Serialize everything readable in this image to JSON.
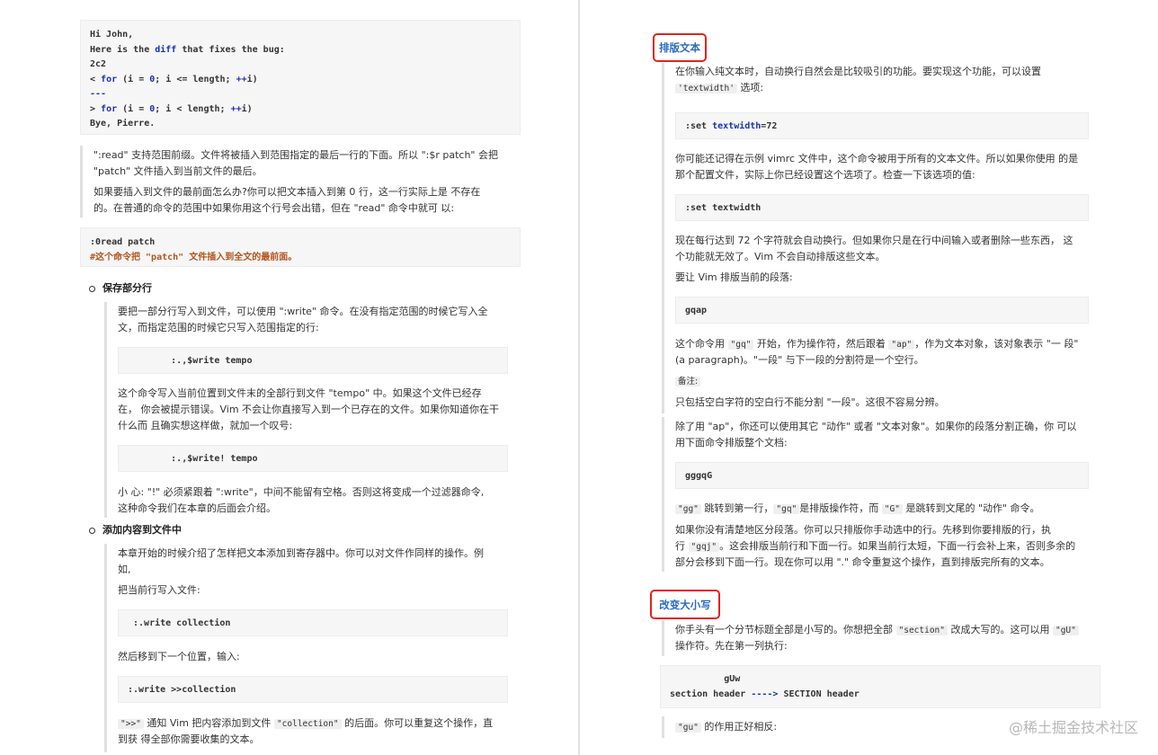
{
  "left": {
    "email_code": [
      "Hi John,",
      "Here is the diff that fixes the bug:",
      "2c2",
      "< for (i = 0; i <= length; ++i)",
      "---",
      "> for (i = 0; i < length; ++i)",
      "Bye, Pierre."
    ],
    "range_note_1": [
      "\":read\" 支持范围前缀。文件将被插入到范围指定的最后一行的下面。所以 \":$r patch\" 会把",
      "\"patch\" 文件插入到当前文件的最后。"
    ],
    "range_note_2": [
      "如果要插入到文件的最前面怎么办?你可以把文本插入到第 0 行，这一行实际上是 不存在",
      "的。在普通的命令的范围中如果你用这个行号会出错，但在 \"read\" 命令中就可 以:"
    ],
    "code_0read": ":0read patch",
    "code_0read_comment": "#这个命令把 \"patch\" 文件插入到全文的最前面。",
    "bullet_1": "保存部分行",
    "save_para_1": [
      "要把一部分行写入到文件，可以使用 \":write\" 命令。在没有指定范围的时候它写入全",
      "文，而指定范围的时候它只写入范围指定的行:"
    ],
    "code_write_tempo": "        :.,$write tempo",
    "save_para_2": [
      "这个命令写入当前位置到文件末的全部行到文件 \"tempo\" 中。如果这个文件已经存",
      "在，  你会被提示错误。Vim 不会让你直接写入到一个已存在的文件。如果你知道你在干",
      "什么而 且确实想这样做，就加一个叹号:"
    ],
    "code_write_tempo_bang": "        :.,$write! tempo",
    "save_para_3": [
      "小 心: \"!\" 必须紧跟着 \":write\"，中间不能留有空格。否则这将变成一个过滤器命令,",
      "这种命令我们在本章的后面会介绍。"
    ],
    "bullet_2": "添加内容到文件中",
    "append_para_1": [
      "本章开始的时候介绍了怎样把文本添加到寄存器中。你可以对文件作同样的操作。例",
      "如,"
    ],
    "append_para_2": "把当前行写入文件:",
    "code_write_collection": " :.write collection",
    "append_para_3": "然后移到下一个位置，输入:",
    "code_append_collection": ":.write >>collection",
    "append_para_4_a": "\">>\"",
    "append_para_4_b": " 通知 Vim 把内容添加到文件 ",
    "append_para_4_c": "\"collection\"",
    "append_para_4_d": " 的后面。你可以重复这个操作，直",
    "append_para_4_line2": "到获 得全部你需要收集的文本。"
  },
  "right": {
    "heading_1": "排版文本",
    "fmt_para_1_line1": "在你输入纯文本时，自动换行自然会是比较吸引的功能。要实现这个功能，可以设置",
    "fmt_para_1_code": "'textwidth'",
    "fmt_para_1_tail": " 选项:",
    "code_set_textwidth_cmd": ":set ",
    "code_set_textwidth_kw": "textwidth",
    "code_set_textwidth_val": "=72",
    "fmt_para_2": [
      "你可能还记得在示例 vimrc 文件中，这个命令被用于所有的文本文件。所以如果你使用 的是",
      "那个配置文件，实际上你已经设置这个选项了。检查一下该选项的值:"
    ],
    "code_set_textwidth_q": ":set textwidth",
    "fmt_para_3": [
      "现在每行达到 72 个字符就会自动换行。但如果你只是在行中间输入或者删除一些东西， 这",
      "个功能就无效了。Vim 不会自动排版这些文本。"
    ],
    "fmt_para_4": "要让 Vim 排版当前的段落:",
    "code_gqap": "gqap",
    "fmt_para_5_a": "这个命令用 ",
    "fmt_para_5_b": "\"gq\"",
    "fmt_para_5_c": " 开始，作为操作符，然后跟着 ",
    "fmt_para_5_d": "\"ap\"",
    "fmt_para_5_e": "，作为文本对象，该对象表示 \"一 段\"",
    "fmt_para_5_line2": "(a paragraph)。\"一段\" 与下一段的分割符是一个空行。",
    "note_label": "备注:",
    "fmt_para_6": "只包括空白字符的空白行不能分割 \"一段\"。这很不容易分辨。",
    "fmt_para_7": [
      "除了用 \"ap\"，你还可以使用其它 \"动作\" 或者 \"文本对象\"。如果你的段落分割正确，你 可以",
      "用下面命令排版整个文档:"
    ],
    "code_gggqG": "gggqG",
    "fmt_para_8_a": "\"gg\"",
    "fmt_para_8_b": " 跳转到第一行，",
    "fmt_para_8_c": "\"gq\"",
    "fmt_para_8_d": "是排版操作符，而 ",
    "fmt_para_8_e": "\"G\"",
    "fmt_para_8_f": " 是跳转到文尾的 \"动作\" 命令。",
    "fmt_para_9_line1": "如果你没有清楚地区分段落。你可以只排版你手动选中的行。先移到你要排版的行，执",
    "fmt_para_9_line2_a": "行 ",
    "fmt_para_9_line2_b": "\"gqj\"",
    "fmt_para_9_line2_c": "。这会排版当前行和下面一行。如果当前行太短，下面一行会补上来，否则多余的",
    "fmt_para_9_line3": "部分会移到下面一行。现在你可以用 \".\" 命令重复这个操作，直到排版完所有的文本。",
    "heading_2": "改变大小写",
    "case_para_1_a": "你手头有一个分节标题全部是小写的。你想把全部 ",
    "case_para_1_b": "\"section\"",
    "case_para_1_c": " 改成大写的。这可以用 ",
    "case_para_1_d": "\"gU\"",
    "case_para_1_line2": "操作符。先在第一列执行:",
    "code_gUw_line1": "          gUw",
    "code_gUw_line2_a": "section header ",
    "code_gUw_line2_b": "---->",
    "code_gUw_line2_c": " SECTION header",
    "case_para_2_a": "\"gu\"",
    "case_para_2_b": " 的作用正好相反:"
  },
  "watermark": "@稀土掘金技术社区",
  "colors": {
    "keyword": "#1a33b3",
    "comment": "#b3541e",
    "heading_text": "#2a6bc2",
    "highlight_box": "#e3231a"
  }
}
